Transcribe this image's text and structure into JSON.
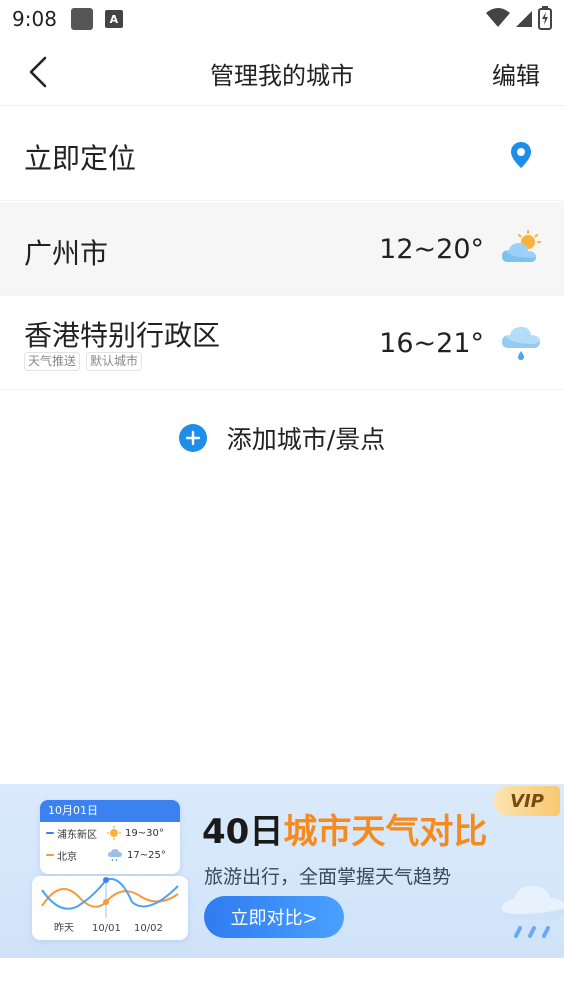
{
  "status_bar": {
    "time": "9:08",
    "a_icon": "A"
  },
  "header": {
    "title": "管理我的城市",
    "edit_label": "编辑"
  },
  "locate": {
    "label": "立即定位",
    "icon": "location-pin-icon",
    "icon_color": "#1e8ee8"
  },
  "cities": [
    {
      "name": "广州市",
      "temp": "12~20°",
      "weather_icon": "partly-cloudy-sun-icon",
      "tags": []
    },
    {
      "name": "香港特别行政区",
      "temp": "16~21°",
      "weather_icon": "cloud-rain-icon",
      "tags": [
        "天气推送",
        "默认城市"
      ]
    }
  ],
  "add_city": {
    "label": "添加城市/景点",
    "icon": "plus-icon"
  },
  "banner": {
    "vip": "VIP",
    "title_part1": "40日",
    "title_part2": "城市天气对比",
    "subtitle": "旅游出行，全面掌握天气趋势",
    "button": "立即对比>",
    "card": {
      "date": "10月01日",
      "rows": [
        {
          "city": "浦东新区",
          "temp": "19~30°",
          "icon": "sun-icon",
          "color": "#3b82f0"
        },
        {
          "city": "北京",
          "temp": "17~25°",
          "icon": "cloud-rain-icon",
          "color": "#f59b3a"
        }
      ],
      "x_labels": [
        "昨天",
        "10/01",
        "10/02"
      ]
    }
  },
  "colors": {
    "accent": "#1e8ee8",
    "orange": "#f58a1f"
  }
}
